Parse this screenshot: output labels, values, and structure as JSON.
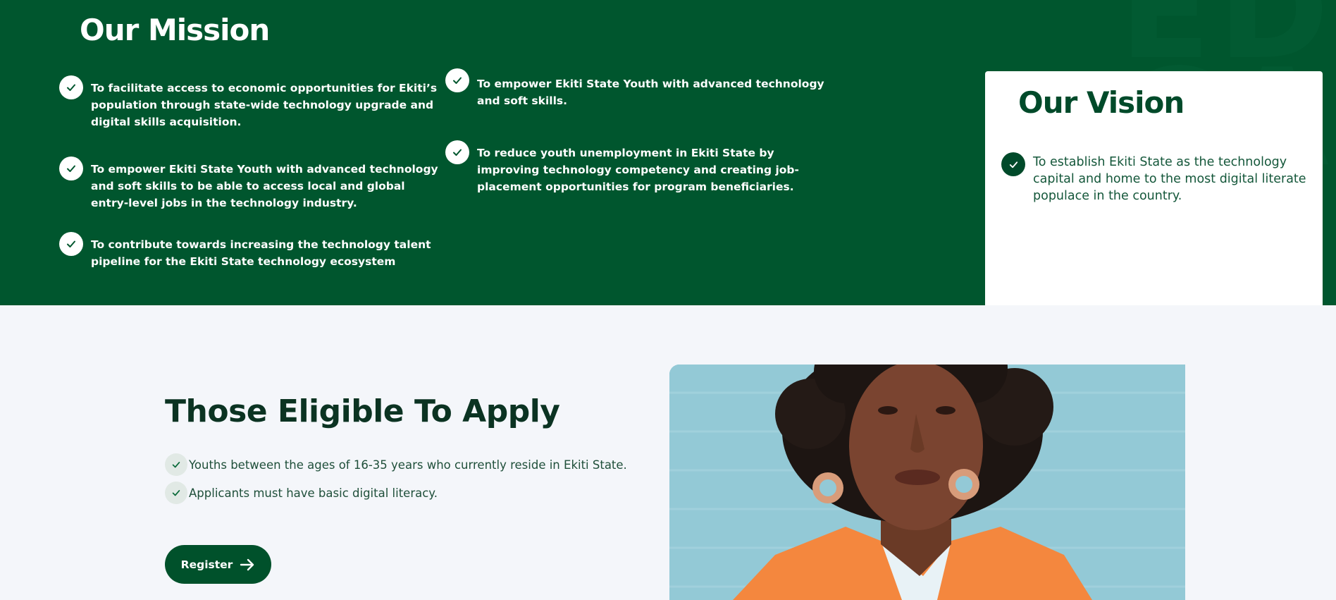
{
  "mission": {
    "title": "Our Mission",
    "bg_letters": "ED\nCA",
    "items": [
      "To facilitate access to economic opportunities for Ekiti’s population through state-wide technology upgrade and digital skills acquisition.",
      "To empower Ekiti State Youth with advanced technology and soft skills to be able to access local and global entry-level jobs in the technology industry.",
      "To contribute towards increasing the technology talent pipeline for the Ekiti State technology ecosystem",
      "To empower Ekiti State Youth with advanced technology and soft skills.",
      "To reduce youth unemployment in Ekiti State by improving technology competency and creating job-placement opportunities for program beneficiaries."
    ]
  },
  "vision": {
    "title": "Our Vision",
    "text": "To establish Ekiti State as the technology capital and home to the most digital literate populace in the country."
  },
  "eligibility": {
    "title": "Those Eligible To Apply",
    "items": [
      "Youths between the ages of 16-35 years who currently reside in Ekiti State.",
      "Applicants must have basic digital literacy."
    ],
    "register_label": "Register"
  },
  "icons": {
    "check": "check-icon",
    "arrow": "arrow-right-icon"
  },
  "colors": {
    "brand_green": "#00562e",
    "dark_green": "#004a2a",
    "page_bg": "#f4f6fa",
    "photo_bg": "#8fc6d3"
  }
}
